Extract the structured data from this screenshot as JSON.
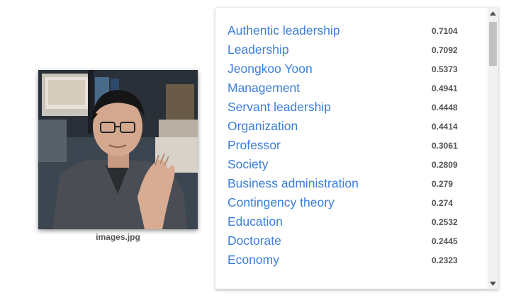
{
  "image": {
    "caption": "images.jpg"
  },
  "labels": [
    {
      "name": "Authentic leadership",
      "score": "0.7104"
    },
    {
      "name": "Leadership",
      "score": "0.7092"
    },
    {
      "name": "Jeongkoo Yoon",
      "score": "0.5373"
    },
    {
      "name": "Management",
      "score": "0.4941"
    },
    {
      "name": "Servant leadership",
      "score": "0.4448"
    },
    {
      "name": "Organization",
      "score": "0.4414"
    },
    {
      "name": "Professor",
      "score": "0.3061"
    },
    {
      "name": "Society",
      "score": "0.2809"
    },
    {
      "name": "Business administration",
      "score": "0.279"
    },
    {
      "name": "Contingency theory",
      "score": "0.274"
    },
    {
      "name": "Education",
      "score": "0.2532"
    },
    {
      "name": "Doctorate",
      "score": "0.2445"
    },
    {
      "name": "Economy",
      "score": "0.2323"
    }
  ],
  "colors": {
    "link": "#3b7dd8",
    "score": "#555555",
    "scroll_track": "#f1f1f1",
    "scroll_thumb": "#c1c1c1"
  },
  "icons": {
    "scroll_up": "triangle-up-icon",
    "scroll_down": "triangle-down-icon"
  }
}
